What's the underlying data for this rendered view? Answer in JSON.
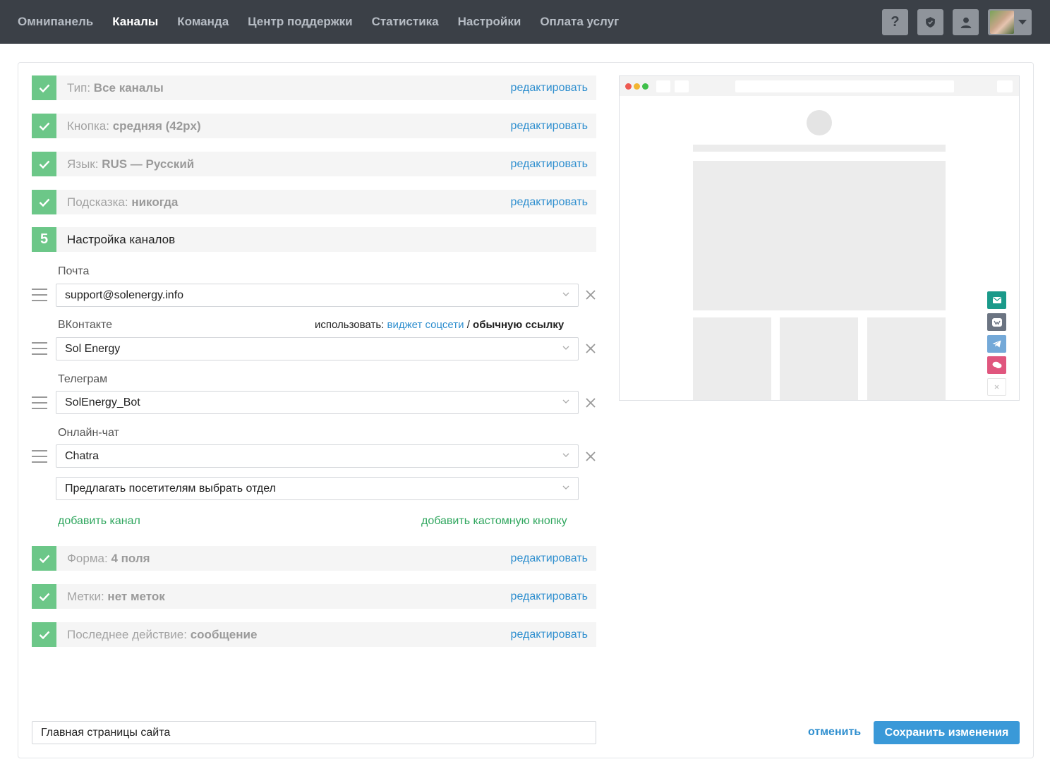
{
  "nav": {
    "items": [
      "Омнипанель",
      "Каналы",
      "Команда",
      "Центр поддержки",
      "Статистика",
      "Настройки",
      "Оплата услуг"
    ],
    "active": "Каналы"
  },
  "top_icons": {
    "help": "?",
    "shield": "shield-icon",
    "user": "user-icon"
  },
  "steps_done_top": [
    {
      "label": "Тип:",
      "value": "Все каналы",
      "edit": "редактировать"
    },
    {
      "label": "Кнопка:",
      "value": "средняя (42px)",
      "edit": "редактировать"
    },
    {
      "label": "Язык:",
      "value": "RUS — Русский",
      "edit": "редактировать"
    },
    {
      "label": "Подсказка:",
      "value": "никогда",
      "edit": "редактировать"
    }
  ],
  "current_step": {
    "number": "5",
    "title": "Настройка каналов"
  },
  "channels": [
    {
      "label": "Почта",
      "value": "support@solenergy.info"
    },
    {
      "label": "ВКонтакте",
      "value": "Sol Energy"
    },
    {
      "label": "Телеграм",
      "value": "SolEnergy_Bot"
    },
    {
      "label": "Онлайн-чат",
      "value": "Chatra"
    }
  ],
  "vk_use": {
    "prefix": "использовать:",
    "widget": "виджет соцсети",
    "sep": "/",
    "link": "обычную ссылку"
  },
  "chat_department": "Предлагать посетителям выбрать отдел",
  "add_channel": "добавить канал",
  "add_custom_button": "добавить кастомную кнопку",
  "steps_done_bottom": [
    {
      "label": "Форма:",
      "value": "4 поля",
      "edit": "редактировать"
    },
    {
      "label": "Метки:",
      "value": "нет меток",
      "edit": "редактировать"
    },
    {
      "label": "Последнее действие:",
      "value": "сообщение",
      "edit": "редактировать"
    }
  ],
  "page_name": "Главная страницы сайта",
  "cancel": "отменить",
  "save": "Сохранить изменения",
  "colors": {
    "accent_green": "#6cc788",
    "link_blue": "#2f8fcf",
    "save_blue": "#3a99d8",
    "topbar": "#3b4047",
    "email_btn": "#1a9a8a",
    "vk_btn": "#6b7482",
    "telegram_btn": "#74a9d8",
    "chat_btn": "#e0567e"
  }
}
